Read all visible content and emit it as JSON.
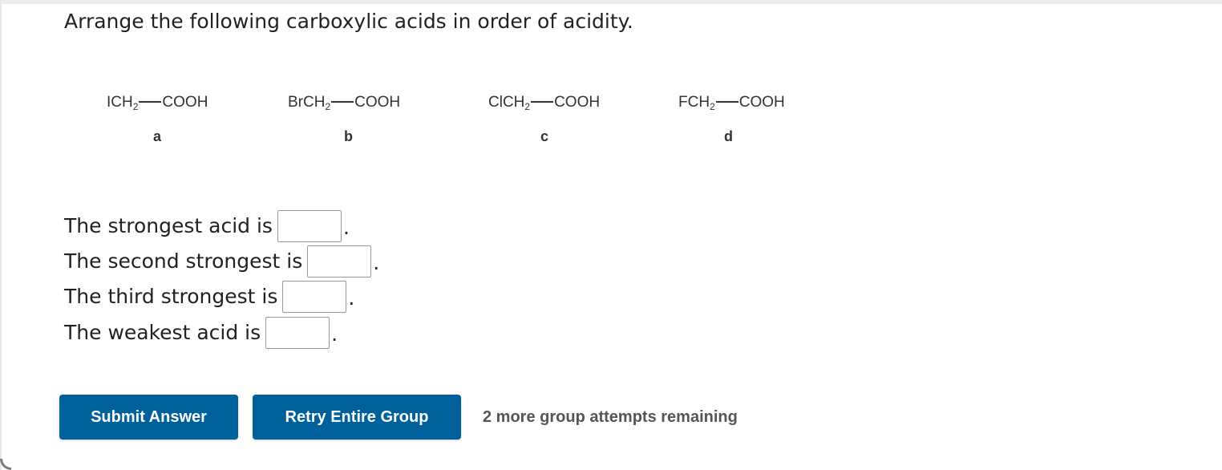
{
  "question": "Arrange the following carboxylic acids in order of acidity.",
  "molecules": [
    {
      "prefix": "ICH",
      "sub": "2",
      "suffix": "COOH",
      "label": "a"
    },
    {
      "prefix": "BrCH",
      "sub": "2",
      "suffix": "COOH",
      "label": "b"
    },
    {
      "prefix": "ClCH",
      "sub": "2",
      "suffix": "COOH",
      "label": "c"
    },
    {
      "prefix": "FCH",
      "sub": "2",
      "suffix": "COOH",
      "label": "d"
    }
  ],
  "answers": [
    {
      "text": "The strongest acid is",
      "value": "",
      "end": "."
    },
    {
      "text": "The second strongest is",
      "value": "",
      "end": "."
    },
    {
      "text": "The third strongest is",
      "value": "",
      "end": "."
    },
    {
      "text": "The weakest acid is",
      "value": "",
      "end": "."
    }
  ],
  "buttons": {
    "submit": "Submit Answer",
    "retry": "Retry Entire Group"
  },
  "attempts_text": "2 more group attempts remaining",
  "colors": {
    "button_bg": "#00609c",
    "button_text": "#ffffff",
    "attempts_text": "#555555"
  }
}
